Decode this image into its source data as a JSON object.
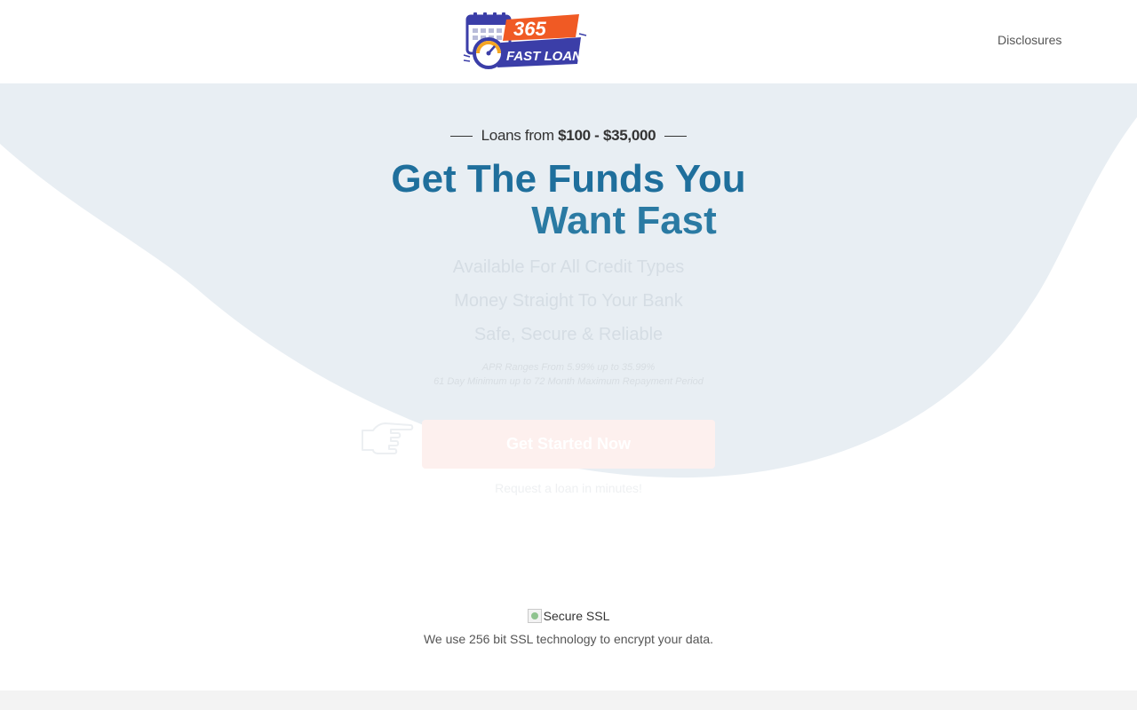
{
  "header": {
    "logo_number": "365",
    "logo_text": "FAST LOANS",
    "nav_link": "Disclosures"
  },
  "hero": {
    "eyebrow_prefix": "Loans from",
    "eyebrow_range": "$100 - $35,000",
    "headline_line1": "Get The Funds You",
    "headline_line2": "Want Fast",
    "features": [
      "Available For All Credit Types",
      "Money Straight To Your Bank",
      "Safe, Secure & Reliable"
    ],
    "fineprint_line1": "APR Ranges From 5.99% up to 35.99%",
    "fineprint_line2": "61 Day Minimum up to 72 Month Maximum Repayment Period",
    "cta_label": "Get Started Now",
    "cta_sub": "Request a loan in minutes!"
  },
  "ssl": {
    "image_alt": "Secure SSL",
    "text": "We use 256 bit SSL technology to encrypt your data."
  },
  "colors": {
    "headline": "#1f6f9c",
    "hero_background": "#e8eef3",
    "logo_orange": "#f05a24",
    "logo_blue": "#3b3ea8"
  },
  "icons": [
    "calendar-icon",
    "speedometer-icon",
    "pointing-hand-icon",
    "broken-image-icon"
  ]
}
